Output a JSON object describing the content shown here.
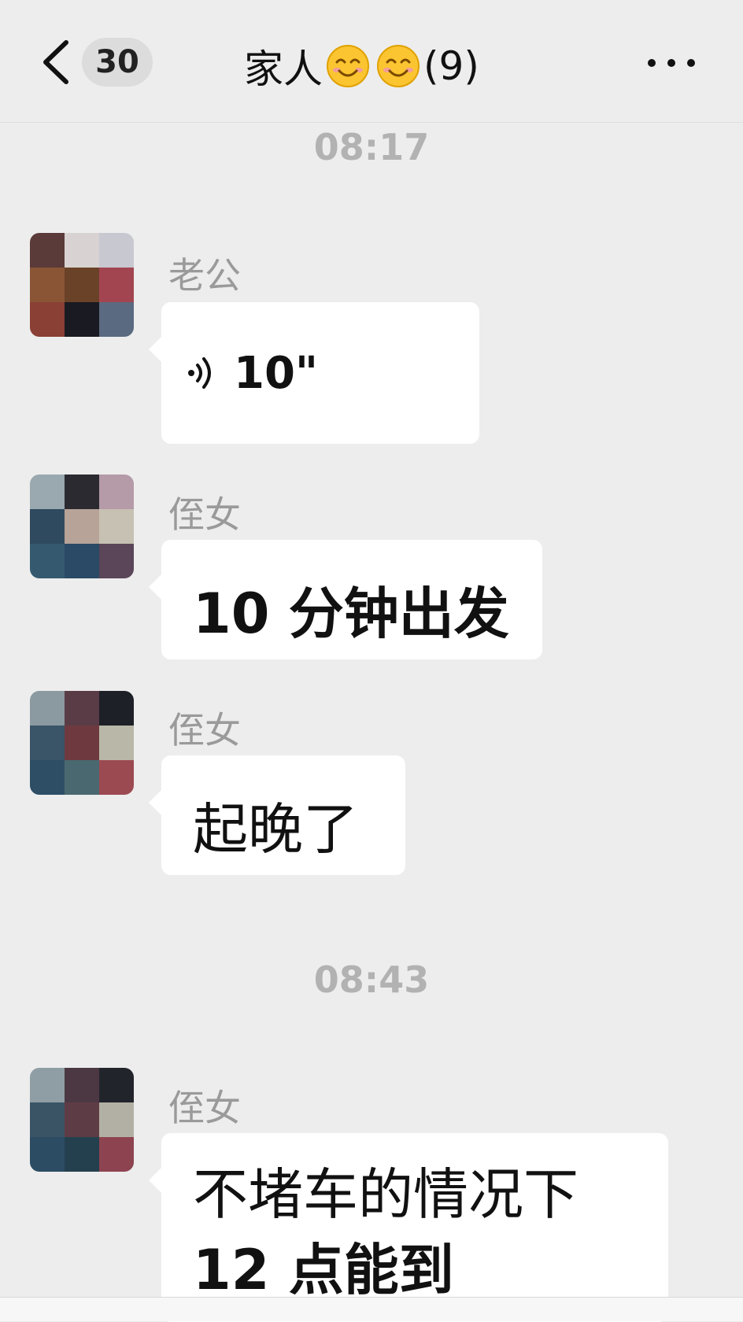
{
  "header": {
    "back_icon": "chevron-left-icon",
    "unread_count": "30",
    "title": "家人",
    "title_emoji": [
      "smiling-face-icon",
      "smiling-face-icon"
    ],
    "member_count": "(9)",
    "more_icon": "more-dots-icon"
  },
  "timestamps": [
    "08:17",
    "08:43"
  ],
  "messages": [
    {
      "sender": "老公",
      "type": "voice",
      "voice_icon": "voice-wave-icon",
      "duration": "10\""
    },
    {
      "sender": "侄女",
      "type": "text",
      "text": "10 分钟出发"
    },
    {
      "sender": "侄女",
      "type": "text",
      "text": "起晚了"
    },
    {
      "sender": "侄女",
      "type": "text",
      "lines": [
        "不堵车的情况下",
        "12 点能到"
      ]
    }
  ],
  "colors": {
    "background": "#ededed",
    "bubble": "#ffffff",
    "timestamp": "#b2b2b2",
    "sender_name": "#9a9a9a"
  }
}
